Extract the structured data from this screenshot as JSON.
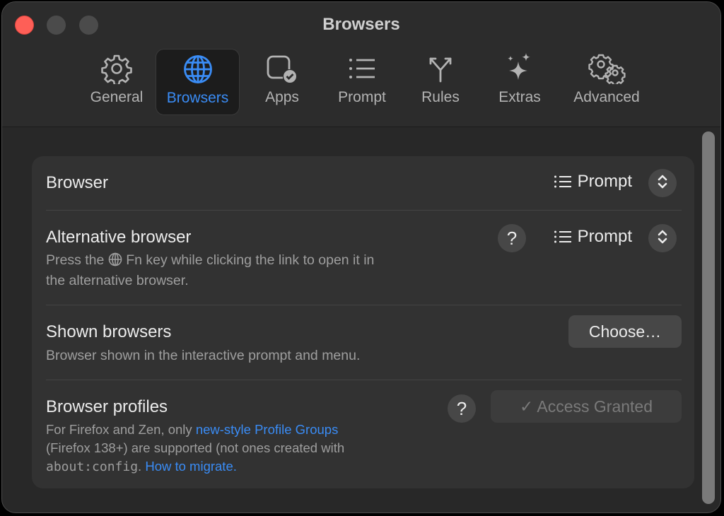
{
  "window": {
    "title": "Browsers"
  },
  "tabs": [
    {
      "label": "General",
      "icon": "gear-icon"
    },
    {
      "label": "Browsers",
      "icon": "globe-icon",
      "selected": true
    },
    {
      "label": "Apps",
      "icon": "app-check-icon"
    },
    {
      "label": "Prompt",
      "icon": "list-icon"
    },
    {
      "label": "Rules",
      "icon": "fork-icon"
    },
    {
      "label": "Extras",
      "icon": "sparkles-icon"
    },
    {
      "label": "Advanced",
      "icon": "gears-icon"
    }
  ],
  "settings": {
    "browser": {
      "title": "Browser",
      "value": "Prompt"
    },
    "alt_browser": {
      "title": "Alternative browser",
      "desc_pre": "Press the",
      "desc_post": "Fn key while clicking the link to open it in",
      "desc_line2": "the alternative browser.",
      "help": "?",
      "value": "Prompt"
    },
    "shown": {
      "title": "Shown browsers",
      "desc": "Browser shown in the interactive prompt and menu.",
      "button": "Choose…"
    },
    "profiles": {
      "title": "Browser profiles",
      "desc_1": "For Firefox and Zen, only",
      "link_1": "new-style Profile Groups",
      "desc_2": "(Firefox 138+) are supported (not ones created with",
      "code": "about:config",
      "desc_3": ".",
      "link_2": "How to migrate.",
      "help": "?",
      "button": "✓ Access Granted"
    }
  },
  "colors": {
    "accent": "#3a8cf5",
    "close": "#fe5f57",
    "background": "#282828",
    "card": "#323232"
  }
}
